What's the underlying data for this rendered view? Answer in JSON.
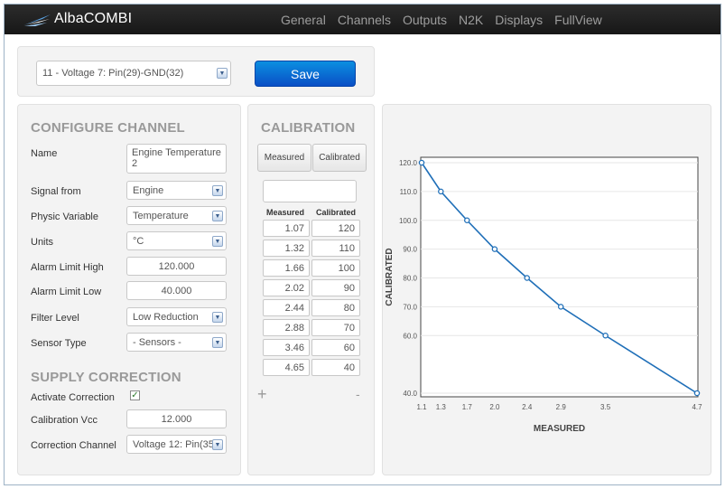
{
  "app": {
    "name": "AlbaCOMBI",
    "logo_icon": "alba-wing-logo",
    "nav": [
      "General",
      "Channels",
      "Outputs",
      "N2K",
      "Displays",
      "FullView"
    ]
  },
  "channel_select": {
    "value": "11 - Voltage 7: Pin(29)-GND(32)"
  },
  "save_label": "Save",
  "config": {
    "title": "CONFIGURE CHANNEL",
    "name_label": "Name",
    "name_value": "Engine Temperature 2",
    "signal_label": "Signal from",
    "signal_value": "Engine",
    "physic_label": "Physic Variable",
    "physic_value": "Temperature",
    "units_label": "Units",
    "units_value": "°C",
    "alarm_high_label": "Alarm Limit High",
    "alarm_high_value": "120.000",
    "alarm_low_label": "Alarm Limit Low",
    "alarm_low_value": "40.000",
    "filter_label": "Filter Level",
    "filter_value": "Low Reduction",
    "sensor_label": "Sensor Type",
    "sensor_value": "- Sensors -",
    "supply_title": "SUPPLY CORRECTION",
    "activate_label": "Activate Correction",
    "activate_checked": true,
    "calib_vcc_label": "Calibration Vcc",
    "calib_vcc_value": "12.000",
    "corr_channel_label": "Correction Channel",
    "corr_channel_value": "Voltage 12: Pin(35"
  },
  "calibration": {
    "title": "CALIBRATION",
    "measured_button": "Measured",
    "calibrated_button": "Calibrated",
    "input_value": "",
    "measured_header": "Measured",
    "calibrated_header": "Calibrated",
    "rows": [
      {
        "measured": "1.07",
        "calibrated": "120"
      },
      {
        "measured": "1.32",
        "calibrated": "110"
      },
      {
        "measured": "1.66",
        "calibrated": "100"
      },
      {
        "measured": "2.02",
        "calibrated": "90"
      },
      {
        "measured": "2.44",
        "calibrated": "80"
      },
      {
        "measured": "2.88",
        "calibrated": "70"
      },
      {
        "measured": "3.46",
        "calibrated": "60"
      },
      {
        "measured": "4.65",
        "calibrated": "40"
      }
    ],
    "add_label": "+",
    "remove_label": "-"
  },
  "chart_data": {
    "type": "line",
    "xlabel": "MEASURED",
    "ylabel": "CALIBRATED",
    "x_ticks": [
      "1.1",
      "1.3",
      "1.7",
      "2.0",
      "2.4",
      "2.9",
      "3.5",
      "4.7"
    ],
    "y_ticks": [
      "120.0",
      "110.0",
      "100.0",
      "90.0",
      "80.0",
      "70.0",
      "60.0",
      "40.0"
    ],
    "x": [
      1.07,
      1.32,
      1.66,
      2.02,
      2.44,
      2.88,
      3.46,
      4.65
    ],
    "y": [
      120,
      110,
      100,
      90,
      80,
      70,
      60,
      40
    ],
    "grid": true,
    "line_color": "#1f6fb8"
  }
}
